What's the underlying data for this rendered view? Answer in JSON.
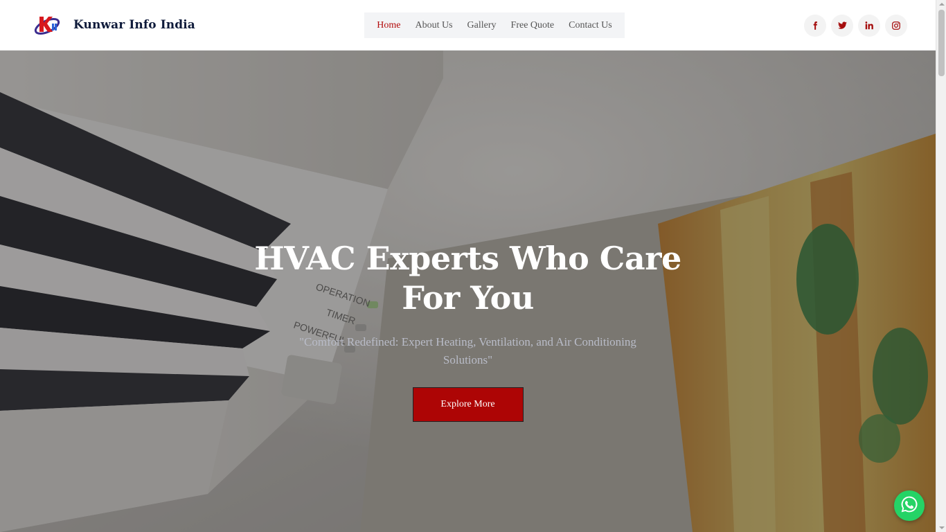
{
  "brand": {
    "name": "Kunwar Info India",
    "logo_icon": "kii-logo"
  },
  "nav": {
    "items": [
      {
        "label": "Home",
        "active": true
      },
      {
        "label": "About Us",
        "active": false
      },
      {
        "label": "Gallery",
        "active": false
      },
      {
        "label": "Free Quote",
        "active": false
      },
      {
        "label": "Contact Us",
        "active": false
      }
    ]
  },
  "socials": [
    {
      "icon": "facebook-icon"
    },
    {
      "icon": "twitter-icon"
    },
    {
      "icon": "linkedin-icon"
    },
    {
      "icon": "instagram-icon"
    }
  ],
  "hero": {
    "title_line1": "HVAC Experts Who Care",
    "title_line2": "For You",
    "subtitle": "\"Comfort Redefined: Expert Heating, Ventilation, and Air Conditioning Solutions\"",
    "button_label": "Explore More",
    "ac_labels": {
      "operation": "OPERATION",
      "timer": "TIMER",
      "powerful": "POWERFUL"
    }
  },
  "floating": {
    "whatsapp_icon": "whatsapp-icon"
  },
  "colors": {
    "accent": "#ad0505",
    "nav_active": "#b30c0c",
    "brand_text": "#0e1a3a",
    "whatsapp": "#25d366"
  }
}
